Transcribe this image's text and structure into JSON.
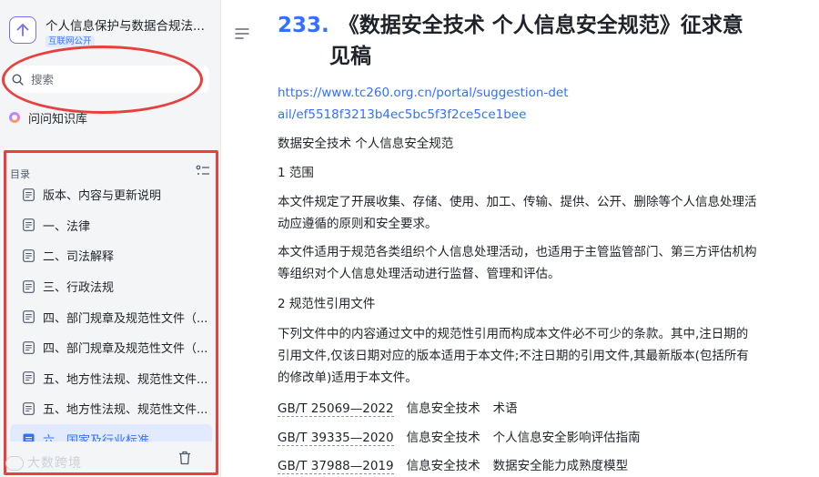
{
  "sidebar": {
    "kb_title": "个人信息保护与数据合规法...",
    "kb_badge": "互联网公开",
    "search_placeholder": "搜索",
    "ask_label": "问问知识库",
    "toc_title": "目录",
    "toc_items": [
      {
        "label": "版本、内容与更新说明",
        "active": false
      },
      {
        "label": "一、法律",
        "active": false
      },
      {
        "label": "二、司法解释",
        "active": false
      },
      {
        "label": "三、行政法规",
        "active": false
      },
      {
        "label": "四、部门规章及规范性文件（...",
        "active": false
      },
      {
        "label": "四、部门规章及规范性文件（...",
        "active": false
      },
      {
        "label": "五、地方性法规、规范性文件...",
        "active": false
      },
      {
        "label": "五、地方性法规、规范性文件...",
        "active": false
      },
      {
        "label": "六、国家及行业标准",
        "active": true
      }
    ],
    "watermark": "大数跨境"
  },
  "main": {
    "heading_number": "233.",
    "heading_line1": "《数据安全技术 个人信息安全规范》征求意",
    "heading_line2": "见稿",
    "link": "https://www.tc260.org.cn/portal/suggestion-detail/ef5518f3213b4ec5bc5f3f2ce5ce1bee",
    "p_title": "数据安全技术 个人信息安全规范",
    "p_scope_head": "1 范围",
    "p_scope_1": "本文件规定了开展收集、存储、使用、加工、传输、提供、公开、删除等个人信息处理活动应遵循的原则和安全要求。",
    "p_scope_2": "本文件适用于规范各类组织个人信息处理活动，也适用于主管监管部门、第三方评估机构等组织对个人信息处理活动进行监督、管理和评估。",
    "p_refs_head": "2 规范性引用文件",
    "p_refs_body": "下列文件中的内容通过文中的规范性引用而构成本文件必不可少的条款。其中,注日期的引用文件,仅该日期对应的版本适用于本文件;不注日期的引用文件,其最新版本(包括所有的修改单)适用于本文件。",
    "standards": [
      {
        "code": "GB/T 25069—2022",
        "field": "信息安全技术",
        "name": "术语"
      },
      {
        "code": "GB/T 39335—2020",
        "field": "信息安全技术",
        "name": "个人信息安全影响评估指南"
      },
      {
        "code": "GB/T 37988—2019",
        "field": "信息安全技术",
        "name": "数据安全能力成熟度模型"
      }
    ]
  },
  "colors": {
    "accent": "#3370ff",
    "annotation": "#e8403f",
    "sidebar_bg": "#f4f5f7"
  }
}
